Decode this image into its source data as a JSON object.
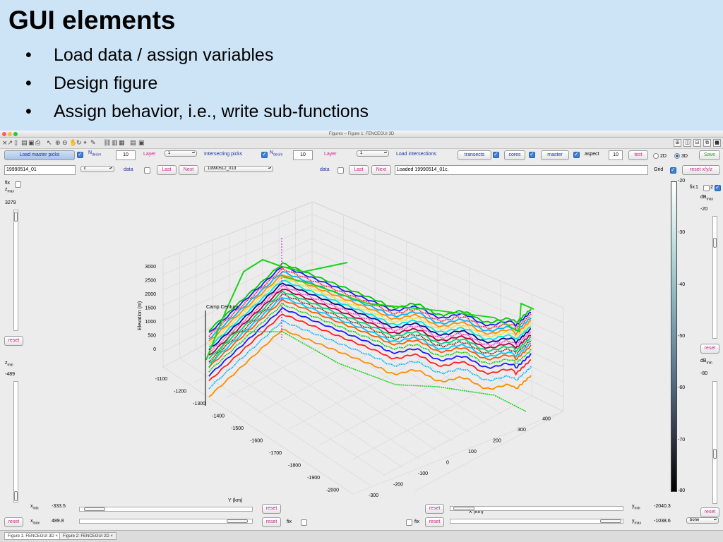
{
  "slide": {
    "title": "GUI elements",
    "bullets": [
      "Load data / assign variables",
      "Design figure",
      "Assign behavior, i.e., write sub-functions"
    ]
  },
  "window": {
    "title": "Figures – Figure 1: FENCEGUI 3D"
  },
  "top_row": {
    "load_master_label": "Load master picks",
    "n_decim_label": "N",
    "n_decim_sub": "decim",
    "n_decim_value": "10",
    "layer_label": "Layer",
    "layer_value": "1",
    "intersecting_label": "Intersecting picks",
    "n_decim2_value": "10",
    "layer2_value": "1",
    "load_intersections_label": "Load intersections",
    "transects_label": "transects",
    "cores_label": "cores",
    "master_label": "master",
    "aspect_label": "aspect",
    "aspect_value": "10",
    "test_label": "test",
    "opt_2d": "2D",
    "opt_3d": "3D",
    "save_label": "Save"
  },
  "second_row": {
    "master_file": "19990514_01",
    "master_popup": "c",
    "data_label": "data",
    "last_label": "Last",
    "next_label": "Next",
    "intersect_popup": "19990512_01d",
    "data2_label": "data",
    "last2_label": "Last",
    "next2_label": "Next",
    "status": "Loaded 19990514_01c.",
    "grid_label": "Grid",
    "reset_xyz_label": "reset x/y/z"
  },
  "left_panel": {
    "fix_label": "fix",
    "zmax_label": "z",
    "zmax_sub": "max",
    "zmax_value": "3279",
    "reset_label": "reset",
    "zmin_label": "z",
    "zmin_sub": "min",
    "zmin_value": "-489"
  },
  "right_panel": {
    "fix_label": "fix",
    "fix_num": "1",
    "fix_num2": "2",
    "dbmax_label": "dB",
    "dbmax_sub": "max",
    "dbmax_value": "-20",
    "reset_label": "reset",
    "dbmin_label": "dB",
    "dbmin_sub": "min",
    "dbmin_value": "-80",
    "reset2_label": "reset",
    "colormap_value": "bone"
  },
  "bottom": {
    "xmin_label": "x",
    "xmin_sub": "min",
    "xmin_value": "-333.5",
    "xmax_label": "x",
    "xmax_sub": "max",
    "xmax_value": "489.8",
    "reset_label": "reset",
    "fix_label": "fix",
    "ymin_label": "y",
    "ymin_sub": "min",
    "ymin_value": "-2040.3",
    "ymax_label": "y",
    "ymax_sub": "max",
    "ymax_value": "-1038.6"
  },
  "colorbar": {
    "ticks": [
      "-20",
      "-30",
      "-40",
      "-50",
      "-60",
      "-70",
      "-80"
    ]
  },
  "plot": {
    "z_label": "Elevation (m)",
    "y_label": "Y (km)",
    "x_label": "X (km)",
    "annotation": "Camp Century",
    "z_ticks": [
      "3000",
      "2500",
      "2000",
      "1500",
      "1000",
      "500",
      "0"
    ],
    "y_ticks": [
      "-1100",
      "-1200",
      "-1300",
      "-1400",
      "-1500",
      "-1600",
      "-1700",
      "-1800",
      "-1900",
      "-2000"
    ],
    "x_ticks": [
      "-300",
      "-200",
      "-100",
      "0",
      "100",
      "200",
      "300",
      "400"
    ],
    "layer_colors": [
      "#00c800",
      "#1a1aff",
      "#ff2020",
      "#00b4ff",
      "#ff8c00",
      "#ffd700",
      "#00e6e6",
      "#0a0a8c",
      "#ff3cc8",
      "#b4003c",
      "#00d27a",
      "#7a2a00",
      "#00c8ff",
      "#ff5a00"
    ]
  },
  "tabs": [
    "Figure 1: FENCEGUI 3D",
    "Figure 2: FENCEGUI 2D"
  ]
}
